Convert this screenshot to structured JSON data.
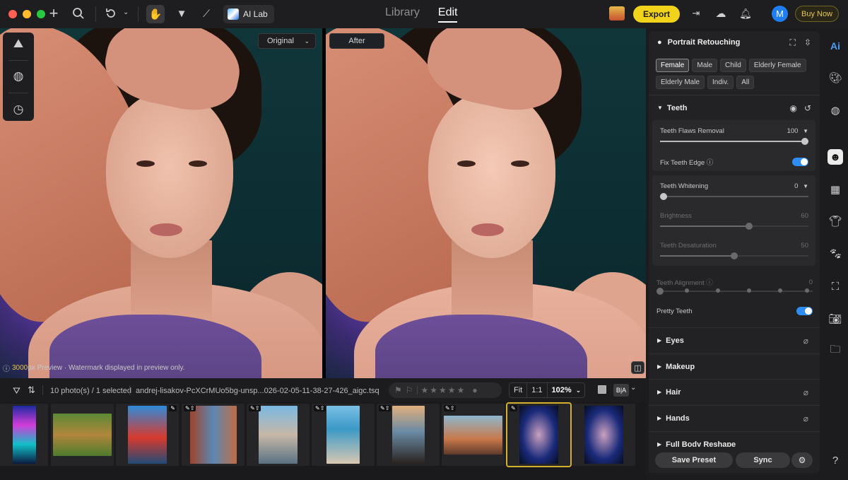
{
  "topbar": {
    "ai_lab": "AI Lab",
    "tabs": [
      {
        "label": "Library",
        "active": false
      },
      {
        "label": "Edit",
        "active": true
      }
    ],
    "export": "Export",
    "avatar_initial": "M",
    "buy_now": "Buy Now"
  },
  "viewer": {
    "original_select": "Original",
    "after_label": "After",
    "watermark_num": "3000",
    "watermark_text": "px Preview · Watermark displayed in preview only."
  },
  "filmbar": {
    "count": "10 photo(s) / 1 selected",
    "filename": "andrej-lisakov-PcXCrMUo5bg-unsp...026-02-05-11-38-27-426_aigc.tsq",
    "stars": 5,
    "zoom_fit": "Fit",
    "zoom_1to1": "1:1",
    "zoom_level": "102%",
    "compare_label": "B|A"
  },
  "panel": {
    "title": "Portrait Retouching",
    "chips": [
      {
        "label": "Female",
        "active": true
      },
      {
        "label": "Male",
        "active": false
      },
      {
        "label": "Child",
        "active": false
      },
      {
        "label": "Elderly Female",
        "active": false
      },
      {
        "label": "Elderly Male",
        "active": false
      },
      {
        "label": "Indiv.",
        "active": false
      },
      {
        "label": "All",
        "active": false
      }
    ],
    "teeth": {
      "title": "Teeth",
      "flaws_label": "Teeth Flaws Removal",
      "flaws_value": "100",
      "flaws_level": 100,
      "fix_edge_label": "Fix Teeth Edge",
      "whitening_label": "Teeth Whitening",
      "whitening_value": "0",
      "whitening_level": 0,
      "brightness_label": "Brightness",
      "brightness_value": "60",
      "brightness_level": 60,
      "desat_label": "Teeth Desaturation",
      "desat_value": "50",
      "desat_level": 50,
      "alignment_label": "Teeth Alignment",
      "alignment_value": "0",
      "pretty_label": "Pretty Teeth"
    },
    "sections": [
      "Eyes",
      "Makeup",
      "Hair",
      "Hands",
      "Full Body Reshape"
    ],
    "save_preset": "Save Preset",
    "sync": "Sync"
  },
  "colors": {
    "accent": "#f2d31b",
    "toggle_on": "#2f8cf2",
    "selected_thumb": "#d4b02c"
  }
}
